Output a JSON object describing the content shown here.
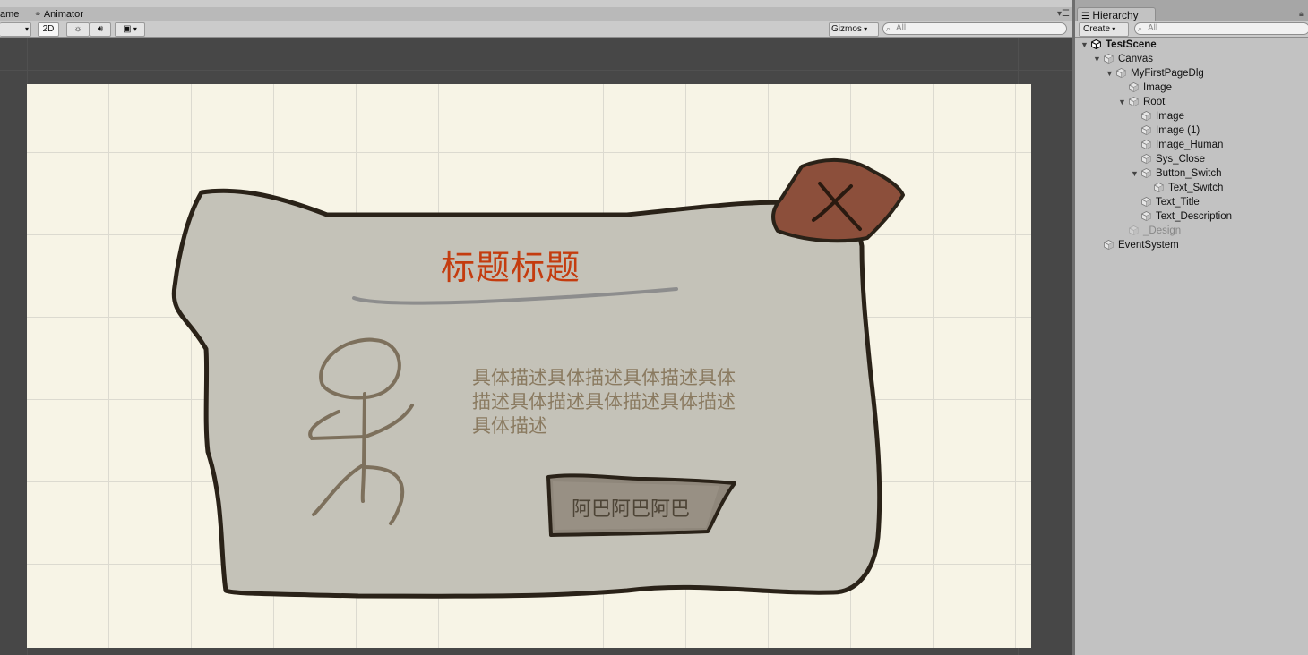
{
  "scene_tabs": {
    "game_partial": "ame",
    "animator": "Animator"
  },
  "scene_toolbar": {
    "mode_2d": "2D",
    "gizmos": "Gizmos",
    "search_placeholder": "All"
  },
  "dialog": {
    "title": "标题标题",
    "description": "具体描述具体描述具体描述具体描述具体描述具体描述具体描述具体描述",
    "switch_label": "阿巴阿巴阿巴",
    "close_icon": "x-icon"
  },
  "hierarchy": {
    "tab_label": "Hierarchy",
    "create_label": "Create",
    "search_placeholder": "All",
    "items": [
      {
        "label": "TestScene",
        "depth": 0,
        "arrow": "open",
        "bold": true,
        "icon": "unity-scene-icon"
      },
      {
        "label": "Canvas",
        "depth": 1,
        "arrow": "open",
        "icon": "cube-icon"
      },
      {
        "label": "MyFirstPageDlg",
        "depth": 2,
        "arrow": "open",
        "icon": "cube-icon"
      },
      {
        "label": "Image",
        "depth": 3,
        "arrow": "none",
        "icon": "cube-icon"
      },
      {
        "label": "Root",
        "depth": 3,
        "arrow": "open",
        "icon": "cube-icon"
      },
      {
        "label": "Image",
        "depth": 4,
        "arrow": "none",
        "icon": "cube-icon"
      },
      {
        "label": "Image (1)",
        "depth": 4,
        "arrow": "none",
        "icon": "cube-icon"
      },
      {
        "label": "Image_Human",
        "depth": 4,
        "arrow": "none",
        "icon": "cube-icon"
      },
      {
        "label": "Sys_Close",
        "depth": 4,
        "arrow": "none",
        "icon": "cube-icon"
      },
      {
        "label": "Button_Switch",
        "depth": 4,
        "arrow": "open",
        "icon": "cube-icon"
      },
      {
        "label": "Text_Switch",
        "depth": 5,
        "arrow": "none",
        "icon": "cube-icon"
      },
      {
        "label": "Text_Title",
        "depth": 4,
        "arrow": "none",
        "icon": "cube-icon"
      },
      {
        "label": "Text_Description",
        "depth": 4,
        "arrow": "none",
        "icon": "cube-icon"
      },
      {
        "label": "_Design",
        "depth": 3,
        "arrow": "none",
        "faded": true,
        "icon": "cube-icon"
      },
      {
        "label": "EventSystem",
        "depth": 1,
        "arrow": "none",
        "icon": "cube-icon"
      }
    ]
  },
  "colors": {
    "title": "#c43c0f",
    "description": "#8a7a60",
    "canvas_bg": "#f7f4e6",
    "panel_fill": "#c4c2b8",
    "close_fill": "#8c4f3b"
  }
}
